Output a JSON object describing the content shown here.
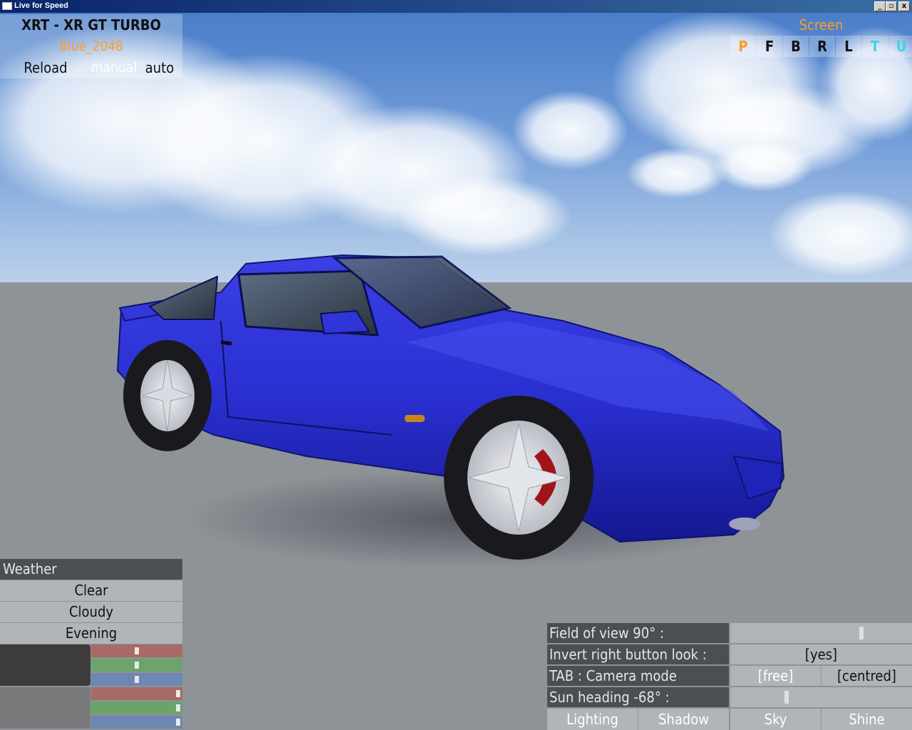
{
  "window": {
    "title": "Live for Speed",
    "minimize": "_",
    "restore": "▫",
    "close": "x"
  },
  "car": {
    "name": "XRT - XR GT TURBO",
    "skin": "Blue_2048",
    "reload": "Reload",
    "manual": "manual",
    "auto": "auto"
  },
  "screen": {
    "title": "Screen",
    "views": [
      {
        "label": "P",
        "color": "#ff9a2a"
      },
      {
        "label": "F",
        "color": "#111111"
      },
      {
        "label": "B",
        "color": "#111111"
      },
      {
        "label": "R",
        "color": "#111111"
      },
      {
        "label": "L",
        "color": "#111111"
      },
      {
        "label": "T",
        "color": "#39d6e6"
      },
      {
        "label": "U",
        "color": "#39d6e6"
      }
    ]
  },
  "weather": {
    "heading": "Weather",
    "options": [
      "Clear",
      "Cloudy",
      "Evening"
    ],
    "ambient_colour": "#3c3c3c",
    "ambient_rgb_levels": [
      0.5,
      0.5,
      0.5
    ],
    "direct_colour": "#7a7a7a",
    "direct_rgb_levels": [
      0.95,
      0.95,
      0.95
    ]
  },
  "camera": {
    "fov_label": "Field of view 90° :",
    "fov_level": 0.72,
    "invert_label": "Invert right button look :",
    "invert_value": "[yes]",
    "tab_label": "TAB : Camera mode",
    "mode_free": "[free]",
    "mode_centred": "[centred]",
    "sun_label": "Sun heading -68° :",
    "sun_level": 0.31,
    "tabs": [
      "Lighting",
      "Shadow",
      "Sky",
      "Shine"
    ]
  },
  "colors": {
    "accent_orange": "#ff9a2a",
    "accent_cyan": "#39d6e6",
    "car_paint": "#2a2fd6",
    "panel_dark": "#4b4e53"
  }
}
